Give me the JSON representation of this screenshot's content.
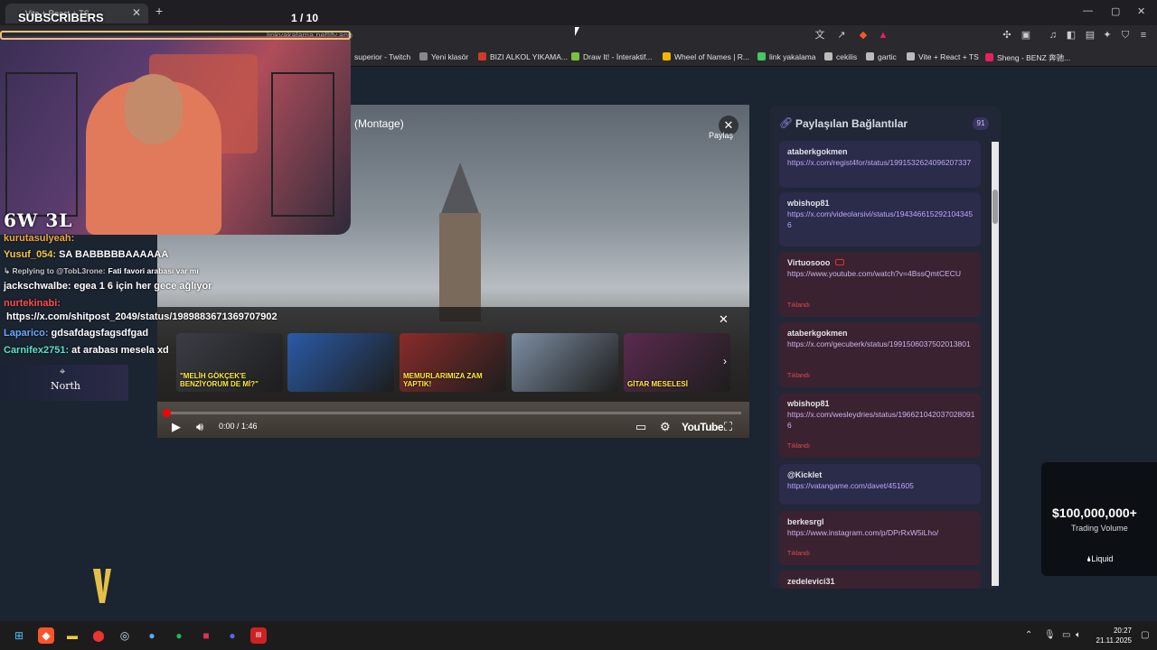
{
  "browser": {
    "tab_title": "Vite + React + TS",
    "url": "linkyakalama.netlify.app",
    "bookmarks": [
      {
        "label": "superior - Twitch",
        "color": "#9146ff"
      },
      {
        "label": "Yeni klasör",
        "color": "#888888"
      },
      {
        "label": "BIZI ALKOL YIKAMA...",
        "color": "#d33a2c"
      },
      {
        "label": "Draw It! - İnteraktif...",
        "color": "#7ac142"
      },
      {
        "label": "Wheel of Names | R...",
        "color": "#f4b400"
      },
      {
        "label": "link yakalama",
        "color": "#44c767"
      },
      {
        "label": "cekilis",
        "color": "#bbbbbb"
      },
      {
        "label": "gartic",
        "color": "#bbbbbb"
      },
      {
        "label": "Vite + React + TS",
        "color": "#bbbbbb"
      },
      {
        "label": "Sheng - BENZ 奔驰...",
        "color": "#e0245e"
      }
    ]
  },
  "overlay": {
    "subscribers_label": "SUBSCRIBERS",
    "pager": "1  / 10",
    "score": "6W 3L",
    "sponsor_label": "North"
  },
  "chat": [
    {
      "user": "kurutasulyeah:",
      "text": "",
      "color": "#f2a93b"
    },
    {
      "user": "Yusuf_054:",
      "text": "SA BABBBBBAAAAAA",
      "color": "#f5c542"
    },
    {
      "user": "↳ Replying to @TobL3rone:",
      "text": "Fati favori arabası var mı",
      "color": "#c8c8c8"
    },
    {
      "user": "jackschwalbe:",
      "text": "egea 1 6 için her gece ağlıyor",
      "color": "#ffffff"
    },
    {
      "user": "nurtekinabi:",
      "text": "",
      "color": "#ff4d4d"
    },
    {
      "user": "",
      "text": "https://x.com/shitpost_2049/status/1989883671369707902",
      "color": "#ffffff"
    },
    {
      "user": "Laparico:",
      "text": "gdsafdagsfagsdfgad",
      "color": "#6fa8ff"
    },
    {
      "user": "Carnifex2751:",
      "text": "at arabası mesela xd",
      "color": "#5ce0c7"
    }
  ],
  "video": {
    "title": "(Montage)",
    "share_label": "Paylaş",
    "time": "0:00 / 1:46",
    "progress": 0.0,
    "brand": "YouTube",
    "endscreen_link": "https://x.com/shitpost_2049/status/1989883671369707902",
    "thumbnails": [
      {
        "caption": "\"MELİH GÖKÇEK'E BENZİYORUM DE Mİ?\"",
        "color": "#3b3d46"
      },
      {
        "caption": "",
        "color": "#2a5ba8"
      },
      {
        "caption": "MEMURLARIMIZA ZAM YAPTIK!",
        "color": "#8a2b2b"
      },
      {
        "caption": "",
        "color": "#7d8fa3"
      },
      {
        "caption": "GİTAR MESELESİ",
        "color": "#5b2a4f"
      }
    ]
  },
  "panel": {
    "title": "Paylaşılan Bağlantılar",
    "count": "91",
    "clicked_label": "Tıklandı",
    "cards": [
      {
        "user": "ataberkgokmen",
        "url": "https://x.com/regist4for/status/1991532624096207337",
        "style": "purple",
        "clicked": false,
        "youtube": false
      },
      {
        "user": "wbishop81",
        "url": "https://x.com/videolarsivi/status/1943466152921043456",
        "style": "purple",
        "clicked": false,
        "youtube": false
      },
      {
        "user": "Virtuosooo",
        "url": "https://www.youtube.com/watch?v=4BssQmtCECU",
        "style": "red",
        "clicked": true,
        "youtube": true
      },
      {
        "user": "ataberkgokmen",
        "url": "https://x.com/gecuberk/status/1991506037502013801",
        "style": "red",
        "clicked": true,
        "youtube": false
      },
      {
        "user": "wbishop81",
        "url": "https://x.com/wesleydries/status/1966210420370280916",
        "style": "red",
        "clicked": true,
        "youtube": false
      },
      {
        "user": "@Kicklet",
        "url": "https://vatangame.com/davet/451605",
        "style": "purple",
        "clicked": false,
        "youtube": false
      },
      {
        "user": "berkesrgl",
        "url": "https://www.instagram.com/p/DPrRxW5iLho/",
        "style": "red",
        "clicked": true,
        "youtube": false
      },
      {
        "user": "zedelevici31",
        "url": "",
        "style": "red",
        "clicked": false,
        "youtube": false
      }
    ]
  },
  "ad": {
    "amount": "$100,000,000+",
    "subtitle": "Trading Volume",
    "brand": "Liquid"
  },
  "taskbar": {
    "time": "20:27",
    "date": "21.11.2025"
  }
}
